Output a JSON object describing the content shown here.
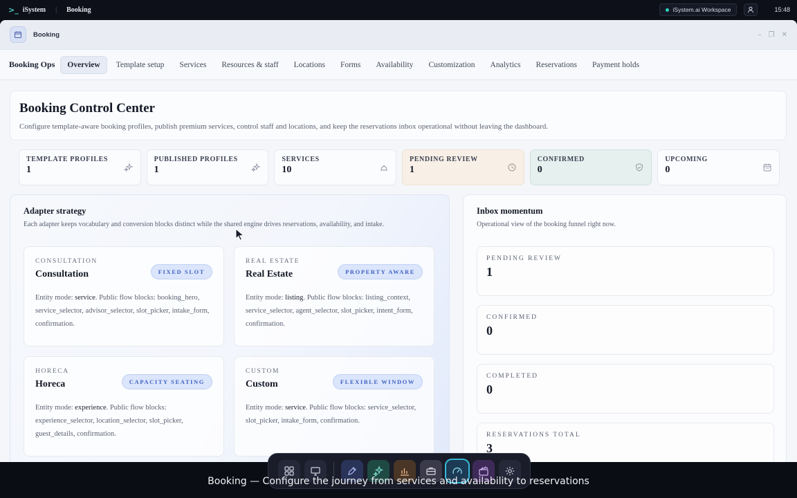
{
  "system_bar": {
    "brand": "iSystem",
    "app": "Booking",
    "workspace": "iSystem.ai Workspace",
    "clock": "15:48"
  },
  "window": {
    "title": "Booking"
  },
  "nav": {
    "brand": "Booking Ops",
    "tabs": [
      "Overview",
      "Template setup",
      "Services",
      "Resources & staff",
      "Locations",
      "Forms",
      "Availability",
      "Customization",
      "Analytics",
      "Reservations",
      "Payment holds"
    ],
    "active_tab": "Overview"
  },
  "hero": {
    "title": "Booking Control Center",
    "description": "Configure template-aware booking profiles, publish premium services, control staff and locations, and keep the reservations inbox operational without leaving the dashboard."
  },
  "stats": [
    {
      "label": "TEMPLATE PROFILES",
      "value": "1",
      "icon": "sparkle-icon",
      "tone": "neutral"
    },
    {
      "label": "PUBLISHED PROFILES",
      "value": "1",
      "icon": "sparkle-icon",
      "tone": "neutral"
    },
    {
      "label": "SERVICES",
      "value": "10",
      "icon": "bell-icon",
      "tone": "neutral"
    },
    {
      "label": "PENDING REVIEW",
      "value": "1",
      "icon": "clock-icon",
      "tone": "warning"
    },
    {
      "label": "CONFIRMED",
      "value": "0",
      "icon": "shield-check-icon",
      "tone": "success"
    },
    {
      "label": "UPCOMING",
      "value": "0",
      "icon": "calendar-icon",
      "tone": "neutral"
    }
  ],
  "adapter_strategy": {
    "title": "Adapter strategy",
    "subtitle": "Each adapter keeps vocabulary and conversion blocks distinct while the shared engine drives reservations, availability, and intake.",
    "adapters": [
      {
        "kind": "CONSULTATION",
        "name": "Consultation",
        "badge": "FIXED SLOT",
        "entity_prefix": "Entity mode: ",
        "entity": "service",
        "blocks": ". Public flow blocks: booking_hero, service_selector, advisor_selector, slot_picker, intake_form, confirmation."
      },
      {
        "kind": "REAL ESTATE",
        "name": "Real Estate",
        "badge": "PROPERTY AWARE",
        "entity_prefix": "Entity mode: ",
        "entity": "listing",
        "blocks": ". Public flow blocks: listing_context, service_selector, agent_selector, slot_picker, intent_form, confirmation."
      },
      {
        "kind": "HORECA",
        "name": "Horeca",
        "badge": "CAPACITY SEATING",
        "entity_prefix": "Entity mode: ",
        "entity": "experience",
        "blocks": ". Public flow blocks: experience_selector, location_selector, slot_picker, guest_details, confirmation."
      },
      {
        "kind": "CUSTOM",
        "name": "Custom",
        "badge": "FLEXIBLE WINDOW",
        "entity_prefix": "Entity mode: ",
        "entity": "service",
        "blocks": ". Public flow blocks: service_selector, slot_picker, intake_form, confirmation."
      }
    ]
  },
  "inbox": {
    "title": "Inbox momentum",
    "subtitle": "Operational view of the booking funnel right now.",
    "metrics": [
      {
        "label": "PENDING REVIEW",
        "value": "1"
      },
      {
        "label": "CONFIRMED",
        "value": "0"
      },
      {
        "label": "COMPLETED",
        "value": "0"
      },
      {
        "label": "RESERVATIONS TOTAL",
        "value": "3"
      }
    ]
  },
  "dock": {
    "items": [
      "grid-icon",
      "monitor-icon",
      "pen-icon",
      "sparkle-icon",
      "chart-icon",
      "briefcase-icon",
      "gauge-icon",
      "clapper-icon",
      "gear-icon"
    ],
    "active": "gauge-icon"
  },
  "caption": "Booking — Configure the journey from services and availability to reservations"
}
